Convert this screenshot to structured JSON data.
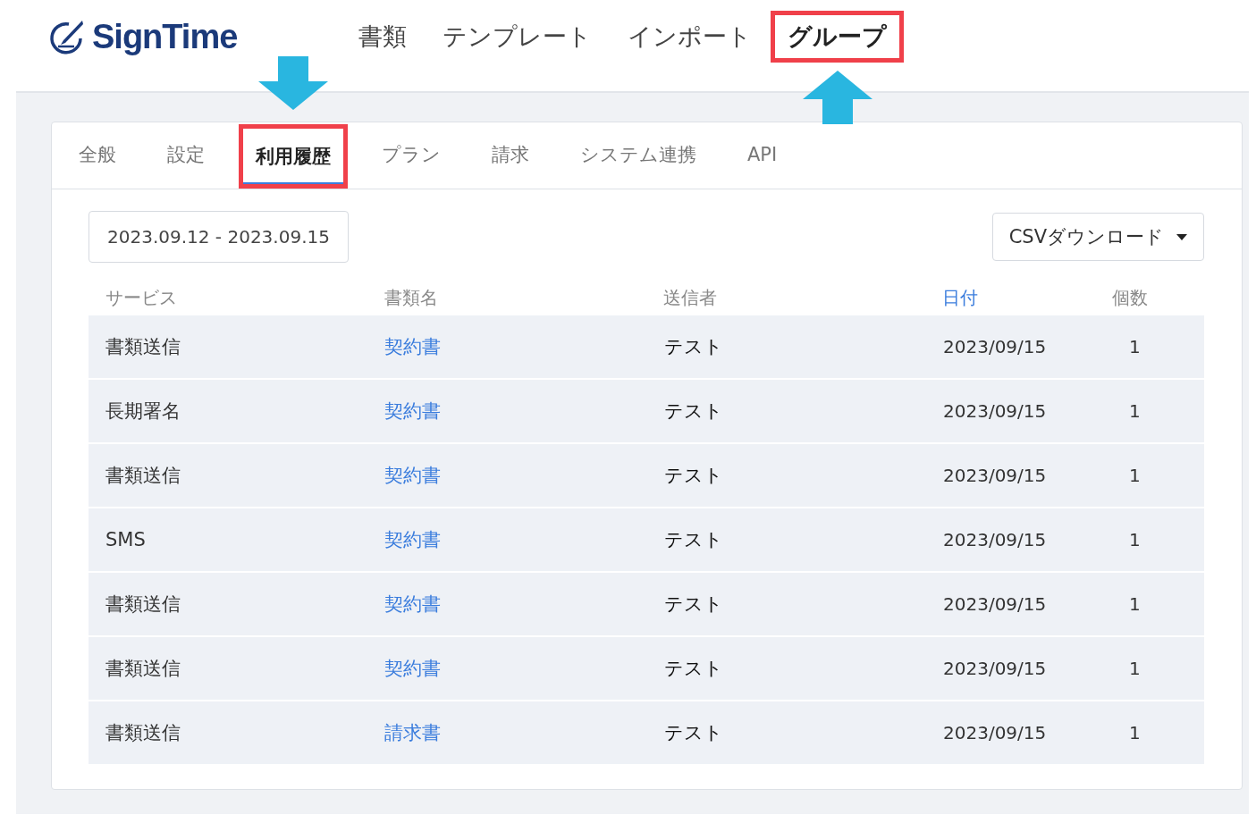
{
  "header": {
    "logo": "SignTime",
    "nav": [
      {
        "label": "書類",
        "selected": false,
        "highlighted": false
      },
      {
        "label": "テンプレート",
        "selected": false,
        "highlighted": false
      },
      {
        "label": "インポート",
        "selected": false,
        "highlighted": false
      },
      {
        "label": "グループ",
        "selected": true,
        "highlighted": true
      }
    ]
  },
  "tabs": [
    {
      "label": "全般",
      "selected": false,
      "highlighted": false
    },
    {
      "label": "設定",
      "selected": false,
      "highlighted": false
    },
    {
      "label": "利用履歴",
      "selected": true,
      "highlighted": true
    },
    {
      "label": "プラン",
      "selected": false,
      "highlighted": false
    },
    {
      "label": "請求",
      "selected": false,
      "highlighted": false
    },
    {
      "label": "システム連携",
      "selected": false,
      "highlighted": false
    },
    {
      "label": "API",
      "selected": false,
      "highlighted": false
    }
  ],
  "date_range": "2023.09.12 - 2023.09.15",
  "csv_button": "CSVダウンロード",
  "table": {
    "columns": [
      {
        "label": "サービス",
        "sortable": false
      },
      {
        "label": "書類名",
        "sortable": false
      },
      {
        "label": "送信者",
        "sortable": false
      },
      {
        "label": "日付",
        "sortable": true
      },
      {
        "label": "個数",
        "sortable": false
      }
    ],
    "rows": [
      [
        "書類送信",
        "契約書",
        "テスト",
        "2023/09/15",
        "1"
      ],
      [
        "長期署名",
        "契約書",
        "テスト",
        "2023/09/15",
        "1"
      ],
      [
        "書類送信",
        "契約書",
        "テスト",
        "2023/09/15",
        "1"
      ],
      [
        "SMS",
        "契約書",
        "テスト",
        "2023/09/15",
        "1"
      ],
      [
        "書類送信",
        "契約書",
        "テスト",
        "2023/09/15",
        "1"
      ],
      [
        "書類送信",
        "契約書",
        "テスト",
        "2023/09/15",
        "1"
      ],
      [
        "書類送信",
        "請求書",
        "テスト",
        "2023/09/15",
        "1"
      ]
    ]
  }
}
